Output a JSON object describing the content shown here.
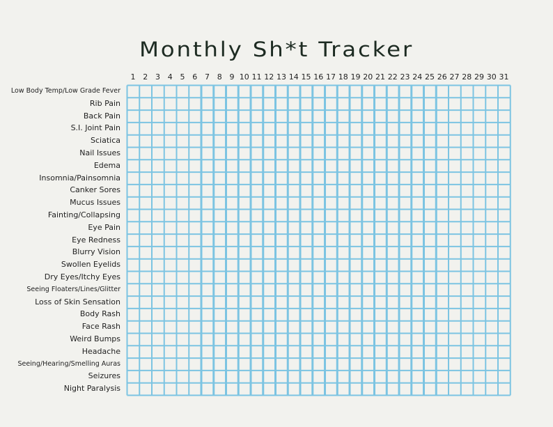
{
  "title": "Monthly Sh*t Tracker",
  "days": [
    "1",
    "2",
    "3",
    "4",
    "5",
    "6",
    "7",
    "8",
    "9",
    "10",
    "11",
    "12",
    "13",
    "14",
    "15",
    "16",
    "17",
    "18",
    "19",
    "20",
    "21",
    "22",
    "23",
    "24",
    "25",
    "26",
    "27",
    "28",
    "29",
    "30",
    "31"
  ],
  "symptoms": [
    "Low Body Temp/Low Grade Fever",
    "Rib Pain",
    "Back Pain",
    "S.I. Joint Pain",
    "Sciatica",
    "Nail Issues",
    "Edema",
    "Insomnia/Painsomnia",
    "Canker Sores",
    "Mucus Issues",
    "Fainting/Collapsing",
    "Eye Pain",
    "Eye Redness",
    "Blurry Vision",
    "Swollen Eyelids",
    "Dry Eyes/Itchy Eyes",
    "Seeing Floaters/Lines/Glitter",
    "Loss of Skin Sensation",
    "Body Rash",
    "Face Rash",
    "Weird Bumps",
    "Headache",
    "Seeing/Hearing/Smelling Auras",
    "Seizures",
    "Night Paralysis"
  ],
  "colors": {
    "grid": "#7cc4e2",
    "background": "#f2f2ee",
    "text": "#1f2a24"
  }
}
